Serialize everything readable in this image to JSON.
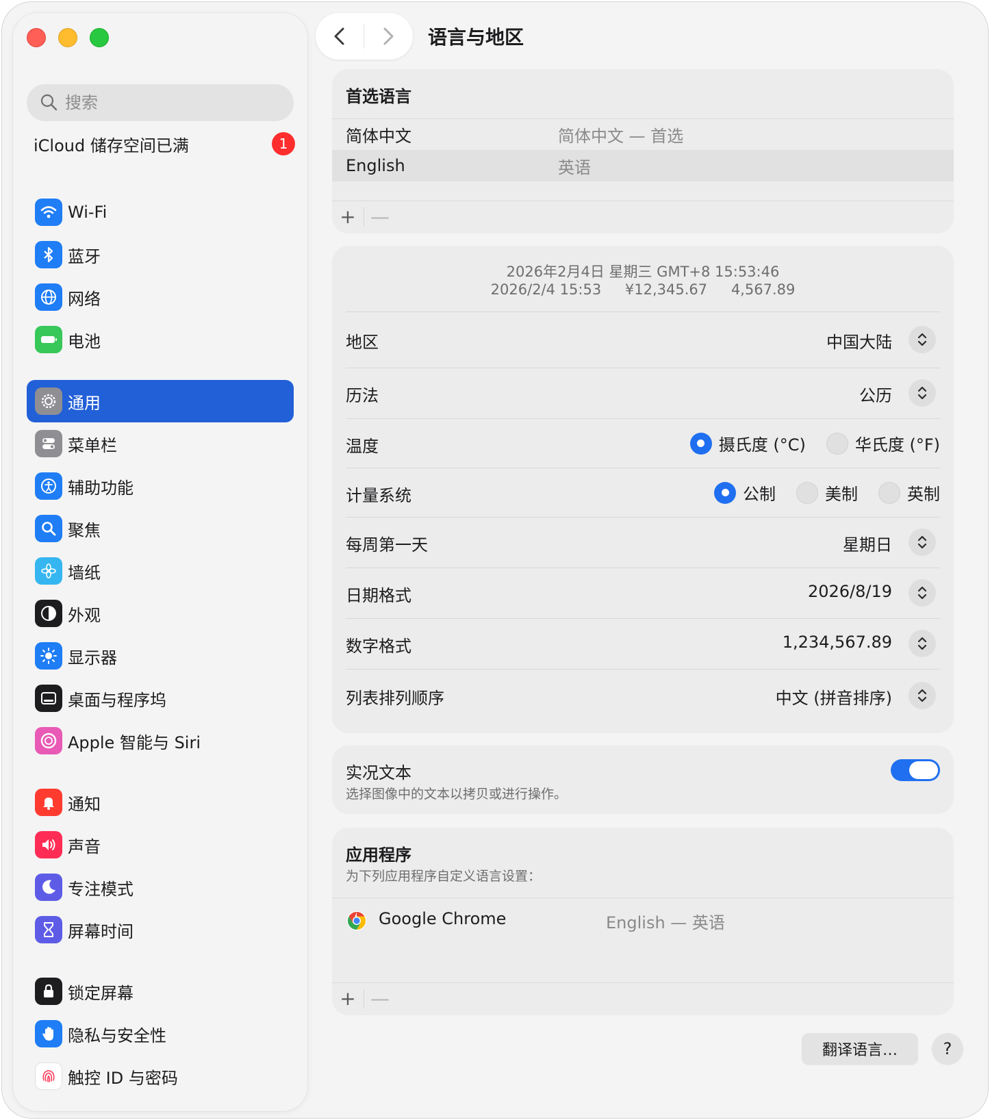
{
  "window": {
    "title": "语言与地区"
  },
  "sidebar": {
    "search_placeholder": "搜索",
    "icloud": {
      "label": "iCloud 储存空间已满",
      "badge": "1"
    },
    "items": [
      {
        "label": "Wi-Fi",
        "icon": "wifi-icon",
        "color": "#1f7df5"
      },
      {
        "label": "蓝牙",
        "icon": "bluetooth-icon",
        "color": "#1f7df5"
      },
      {
        "label": "网络",
        "icon": "globe-icon",
        "color": "#1f7df5"
      },
      {
        "label": "电池",
        "icon": "battery-icon",
        "color": "#38c759"
      },
      {
        "label": "通用",
        "icon": "gear-icon",
        "color": "#8e8e93",
        "selected": true
      },
      {
        "label": "菜单栏",
        "icon": "menubar-icon",
        "color": "#8e8e93"
      },
      {
        "label": "辅助功能",
        "icon": "accessibility-icon",
        "color": "#1f7df5"
      },
      {
        "label": "聚焦",
        "icon": "spotlight-icon",
        "color": "#1f7df5"
      },
      {
        "label": "墙纸",
        "icon": "wallpaper-icon",
        "color": "#35b6f0"
      },
      {
        "label": "外观",
        "icon": "appearance-icon",
        "color": "#1d1d1f"
      },
      {
        "label": "显示器",
        "icon": "display-icon",
        "color": "#1f7df5"
      },
      {
        "label": "桌面与程序坞",
        "icon": "dock-icon",
        "color": "#1d1d1f"
      },
      {
        "label": "Apple 智能与 Siri",
        "icon": "siri-icon",
        "color": "#e85ab5"
      },
      {
        "label": "通知",
        "icon": "notification-icon",
        "color": "#ff3b30"
      },
      {
        "label": "声音",
        "icon": "sound-icon",
        "color": "#ff2d55"
      },
      {
        "label": "专注模式",
        "icon": "moon-icon",
        "color": "#5e5ce6"
      },
      {
        "label": "屏幕时间",
        "icon": "hourglass-icon",
        "color": "#5e5ce6"
      },
      {
        "label": "锁定屏幕",
        "icon": "lock-icon",
        "color": "#1d1d1f"
      },
      {
        "label": "隐私与安全性",
        "icon": "hand-icon",
        "color": "#1f7df5"
      },
      {
        "label": "触控 ID 与密码",
        "icon": "fingerprint-icon",
        "color": "#ffffff"
      }
    ]
  },
  "preferred_languages": {
    "title": "首选语言",
    "rows": [
      {
        "name": "简体中文",
        "detail": "简体中文 — 首选"
      },
      {
        "name": "English",
        "detail": "英语"
      }
    ],
    "add": "+",
    "remove": "—"
  },
  "region_format": {
    "preview_line1": "2026年2月4日 星期三 GMT+8 15:53:46",
    "preview_line2": [
      "2026/2/4 15:53",
      "¥12,345.67",
      "4,567.89"
    ],
    "region": {
      "label": "地区",
      "value": "中国大陆"
    },
    "calendar": {
      "label": "历法",
      "value": "公历"
    },
    "temperature": {
      "label": "温度",
      "options": [
        "摄氏度 (°C)",
        "华氏度 (°F)"
      ],
      "selected": 0
    },
    "measurement": {
      "label": "计量系统",
      "options": [
        "公制",
        "美制",
        "英制"
      ],
      "selected": 0
    },
    "first_day": {
      "label": "每周第一天",
      "value": "星期日"
    },
    "date_format": {
      "label": "日期格式",
      "value": "2026/8/19"
    },
    "number_format": {
      "label": "数字格式",
      "value": "1,234,567.89"
    },
    "list_sort": {
      "label": "列表排列顺序",
      "value": "中文 (拼音排序)"
    }
  },
  "live_text": {
    "title": "实况文本",
    "subtitle": "选择图像中的文本以拷贝或进行操作。",
    "enabled": true
  },
  "applications": {
    "title": "应用程序",
    "subtitle": "为下列应用程序自定义语言设置：",
    "apps": [
      {
        "name": "Google Chrome",
        "language": "English — 英语"
      }
    ],
    "add": "+",
    "remove": "—"
  },
  "footer": {
    "translate_button": "翻译语言…",
    "help_button": "?"
  }
}
